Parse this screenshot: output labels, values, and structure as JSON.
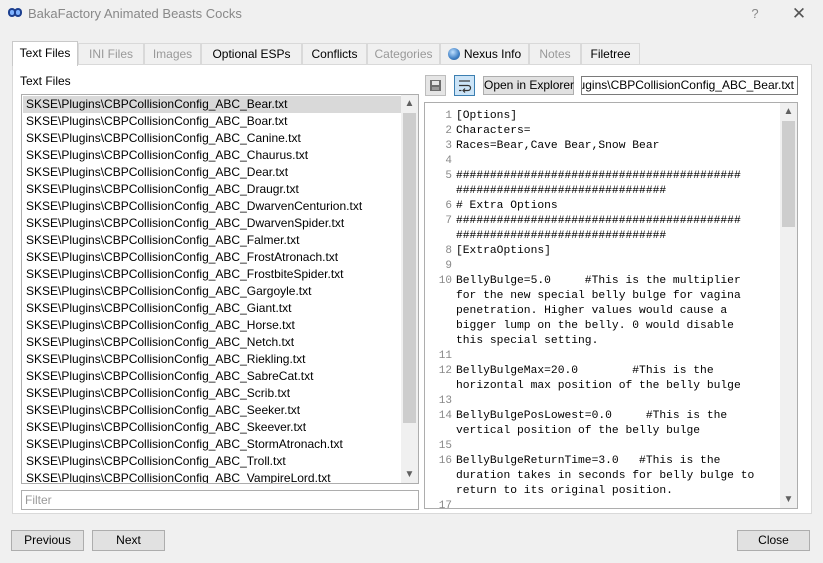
{
  "window": {
    "title": "BakaFactory Animated Beasts Cocks",
    "help_label": "?",
    "close_glyph": "✕",
    "app_icon": "mo2-logo-icon"
  },
  "tabs": [
    {
      "label": "Text Files",
      "active": true,
      "disabled": false
    },
    {
      "label": "INI Files",
      "active": false,
      "disabled": true
    },
    {
      "label": "Images",
      "active": false,
      "disabled": true
    },
    {
      "label": "Optional ESPs",
      "active": false,
      "disabled": false
    },
    {
      "label": "Conflicts",
      "active": false,
      "disabled": false
    },
    {
      "label": "Categories",
      "active": false,
      "disabled": true
    },
    {
      "label": "Nexus Info",
      "active": false,
      "disabled": false,
      "icon": "globe-icon"
    },
    {
      "label": "Notes",
      "active": false,
      "disabled": true
    },
    {
      "label": "Filetree",
      "active": false,
      "disabled": false
    }
  ],
  "text_files": {
    "label": "Text Files",
    "selected_index": 0,
    "files": [
      "SKSE\\Plugins\\CBPCollisionConfig_ABC_Bear.txt",
      "SKSE\\Plugins\\CBPCollisionConfig_ABC_Boar.txt",
      "SKSE\\Plugins\\CBPCollisionConfig_ABC_Canine.txt",
      "SKSE\\Plugins\\CBPCollisionConfig_ABC_Chaurus.txt",
      "SKSE\\Plugins\\CBPCollisionConfig_ABC_Dear.txt",
      "SKSE\\Plugins\\CBPCollisionConfig_ABC_Draugr.txt",
      "SKSE\\Plugins\\CBPCollisionConfig_ABC_DwarvenCenturion.txt",
      "SKSE\\Plugins\\CBPCollisionConfig_ABC_DwarvenSpider.txt",
      "SKSE\\Plugins\\CBPCollisionConfig_ABC_Falmer.txt",
      "SKSE\\Plugins\\CBPCollisionConfig_ABC_FrostAtronach.txt",
      "SKSE\\Plugins\\CBPCollisionConfig_ABC_FrostbiteSpider.txt",
      "SKSE\\Plugins\\CBPCollisionConfig_ABC_Gargoyle.txt",
      "SKSE\\Plugins\\CBPCollisionConfig_ABC_Giant.txt",
      "SKSE\\Plugins\\CBPCollisionConfig_ABC_Horse.txt",
      "SKSE\\Plugins\\CBPCollisionConfig_ABC_Netch.txt",
      "SKSE\\Plugins\\CBPCollisionConfig_ABC_Riekling.txt",
      "SKSE\\Plugins\\CBPCollisionConfig_ABC_SabreCat.txt",
      "SKSE\\Plugins\\CBPCollisionConfig_ABC_Scrib.txt",
      "SKSE\\Plugins\\CBPCollisionConfig_ABC_Seeker.txt",
      "SKSE\\Plugins\\CBPCollisionConfig_ABC_Skeever.txt",
      "SKSE\\Plugins\\CBPCollisionConfig_ABC_StormAtronach.txt",
      "SKSE\\Plugins\\CBPCollisionConfig_ABC_Troll.txt",
      "SKSE\\Plugins\\CBPCollisionConfig_ABC_VampireLord.txt"
    ],
    "filter_placeholder": "Filter",
    "filter_value": ""
  },
  "viewer": {
    "save_icon": "save-icon",
    "wrap_icon": "word-wrap-icon",
    "open_label": "Open in Explorer",
    "path": "SKSE\\Plugins\\CBPCollisionConfig_ABC_Bear.txt",
    "lines": [
      {
        "n": "1",
        "text": [
          "[Options]"
        ]
      },
      {
        "n": "2",
        "text": [
          "Characters="
        ]
      },
      {
        "n": "3",
        "text": [
          "Races=Bear,Cave Bear,Snow Bear"
        ]
      },
      {
        "n": "4",
        "text": [
          ""
        ]
      },
      {
        "n": "5",
        "text": [
          "##########################################",
          "###############################"
        ]
      },
      {
        "n": "6",
        "text": [
          "# Extra Options"
        ]
      },
      {
        "n": "7",
        "text": [
          "##########################################",
          "###############################"
        ]
      },
      {
        "n": "8",
        "text": [
          "[ExtraOptions]"
        ]
      },
      {
        "n": "9",
        "text": [
          ""
        ]
      },
      {
        "n": "10",
        "text": [
          "BellyBulge=5.0     #This is the multiplier",
          "for the new special belly bulge for vagina",
          "penetration. Higher values would cause a",
          "bigger lump on the belly. 0 would disable",
          "this special setting."
        ]
      },
      {
        "n": "11",
        "text": [
          ""
        ]
      },
      {
        "n": "12",
        "text": [
          "BellyBulgeMax=20.0        #This is the",
          "horizontal max position of the belly bulge"
        ]
      },
      {
        "n": "13",
        "text": [
          ""
        ]
      },
      {
        "n": "14",
        "text": [
          "BellyBulgePosLowest=0.0     #This is the",
          "vertical position of the belly bulge"
        ]
      },
      {
        "n": "15",
        "text": [
          ""
        ]
      },
      {
        "n": "16",
        "text": [
          "BellyBulgeReturnTime=3.0   #This is the",
          "duration takes in seconds for belly bulge to",
          "return to its original position."
        ]
      },
      {
        "n": "17",
        "text": [
          ""
        ]
      }
    ]
  },
  "footer": {
    "previous_label": "Previous",
    "next_label": "Next",
    "close_label": "Close"
  }
}
